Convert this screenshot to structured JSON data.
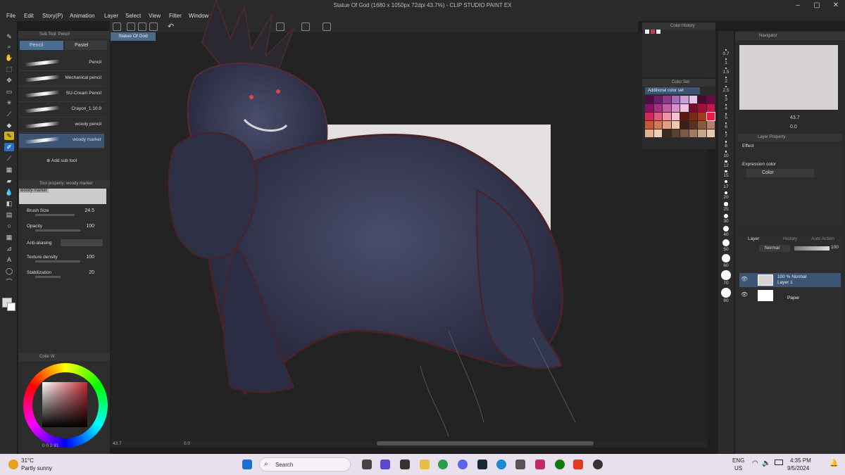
{
  "window": {
    "title": "Statue Of God (1680 x 1050px 72dpi 43.7%)  - CLIP STUDIO PAINT EX"
  },
  "menu": [
    "File",
    "Edit",
    "Story(P)",
    "Animation",
    "Layer",
    "Select",
    "View",
    "Filter",
    "Window"
  ],
  "document_tab": "Statue Of God",
  "sub_tool": {
    "panel_title": "Sub Tool: Pencil",
    "tabs": [
      "Pencil",
      "Pastel"
    ],
    "brushes": [
      "Pencil",
      "Mechanical pencil",
      "SU-Cream Pencil",
      "Crayon_1.10.9",
      "woody pencil",
      "woody marker"
    ],
    "selected": "woody marker",
    "add_label": "Add sub tool"
  },
  "tool_property": {
    "panel_title": "Tool property: woody marker",
    "preview_label": "woody marker",
    "brush_size_label": "Brush Size",
    "brush_size": "24.5",
    "opacity_label": "Opacity",
    "opacity": "100",
    "anti_aliasing_label": "Anti-aliasing",
    "texture_density_label": "Texture density",
    "texture_density": "100",
    "stabilization_label": "Stabilization",
    "stabilization": "20"
  },
  "color_wheel": {
    "panel_title": "Color W",
    "readout": [
      "0",
      "0",
      "2",
      "81"
    ],
    "accent": "#c02a34"
  },
  "color_history": {
    "panel_title": "Color History"
  },
  "color_set": {
    "panel_title": "Color Set",
    "set_name": "Additional color set"
  },
  "status_bar": {
    "zoom": "43.7",
    "rotation": "0.0"
  },
  "brush_sizes": [
    "0.7",
    "1",
    "1.5",
    "2",
    "2.5",
    "3",
    "4",
    "5",
    "6",
    "7",
    "8",
    "10",
    "12",
    "15",
    "17",
    "20",
    "25",
    "30",
    "40",
    "50",
    "60",
    "70",
    "80"
  ],
  "navigator": {
    "panel_title": "Navigator",
    "zoom": "43.7",
    "angle": "0.0"
  },
  "layer_property": {
    "panel_title": "Layer Property",
    "effect_label": "Effect",
    "expression_color_label": "Expression color",
    "expression_color": "Color"
  },
  "layers": {
    "tabs": [
      "Layer",
      "History",
      "Auto Action"
    ],
    "blend_mode": "Normal",
    "opacity": "100",
    "rows": [
      {
        "meta": "100 % Normal",
        "name": "Layer 1"
      },
      {
        "meta": "",
        "name": "Paper"
      }
    ]
  },
  "taskbar": {
    "weather_temp": "31°C",
    "weather_desc": "Partly sunny",
    "search_label": "Search",
    "lang": "ENG",
    "region": "US",
    "time": "4:35 PM",
    "date": "9/5/2024"
  }
}
